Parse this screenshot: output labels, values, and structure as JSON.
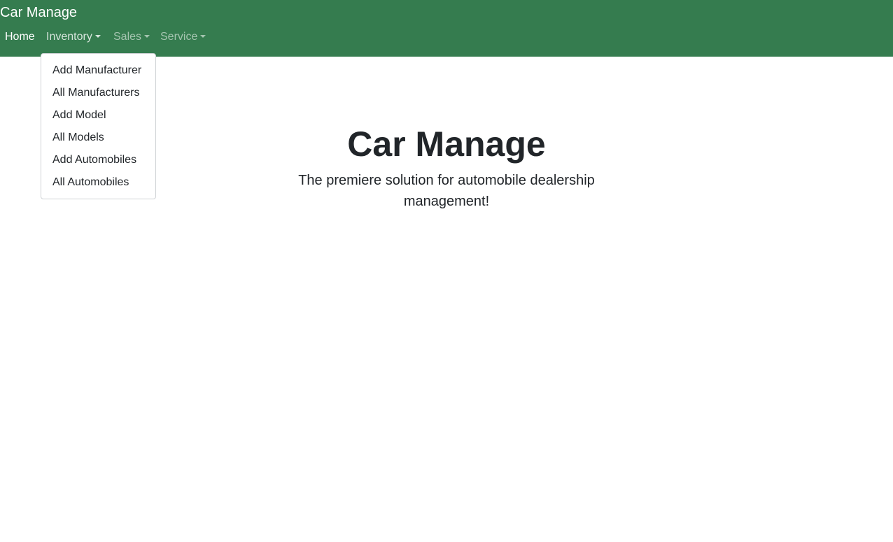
{
  "navbar": {
    "brand": "Car Manage",
    "background_color": "#357c4f",
    "items": [
      {
        "label": "Home",
        "active": true,
        "has_dropdown": false
      },
      {
        "label": "Inventory",
        "active": false,
        "has_dropdown": true,
        "expanded": true
      },
      {
        "label": "Sales",
        "active": false,
        "has_dropdown": true,
        "expanded": false
      },
      {
        "label": "Service",
        "active": false,
        "has_dropdown": true,
        "expanded": false
      }
    ]
  },
  "inventory_menu": {
    "items": [
      "Add Manufacturer",
      "All Manufacturers",
      "Add Model",
      "All Models",
      "Add Automobiles",
      "All Automobiles"
    ]
  },
  "hero": {
    "title": "Car Manage",
    "lead": "The premiere solution for automobile dealership management!"
  }
}
